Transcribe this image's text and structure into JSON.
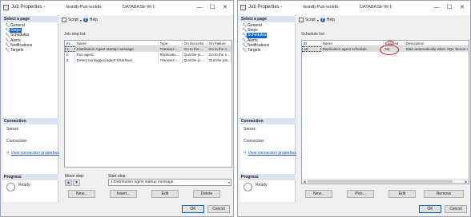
{
  "left_window": {
    "title": "Job Properties -",
    "title_job": "-testdb-Pub-testdb-",
    "title_server": "DATABASE-W-1",
    "select_page_header": "Select a page",
    "pages": [
      "General",
      "Steps",
      "Schedules",
      "Alerts",
      "Notifications",
      "Targets"
    ],
    "selected_page": "Steps",
    "toolbar": {
      "script_label": "Script",
      "help_label": "Help"
    },
    "list_label": "Job step list:",
    "columns": [
      "St...",
      "Name",
      "Type",
      "On Success",
      "On Failure"
    ],
    "rows": [
      [
        "1",
        "Distribution Agent startup message.",
        "Transact-...",
        "Go to the ...",
        "Go to the n..."
      ],
      [
        "2",
        "Run agent.",
        "Replicatio...",
        "Quit the jo...",
        "Go to the n..."
      ],
      [
        "3",
        "Detect nonlogged agent shutdown.",
        "Transact-...",
        "Quit the jo...",
        "Quit the job..."
      ]
    ],
    "connection_header": "Connection",
    "server_label": "Server:",
    "connection_label": "Connection:",
    "view_conn_link": "View connection properties",
    "progress_header": "Progress",
    "progress_status": "Ready",
    "move_step_label": "Move step:",
    "start_step_label": "Start step:",
    "start_step_value": "1:Distribution Agent startup message.",
    "buttons": {
      "new": "New...",
      "insert": "Insert...",
      "edit": "Edit",
      "delete": "Delete",
      "ok": "OK",
      "cancel": "Cancel"
    }
  },
  "right_window": {
    "title": "Job Properties -",
    "title_job": "-testdb-Pub-testdb-",
    "title_server": "DATABASE-W-1",
    "select_page_header": "Select a page",
    "pages": [
      "General",
      "Steps",
      "Schedules",
      "Alerts",
      "Notifications",
      "Targets"
    ],
    "selected_page": "Schedules",
    "toolbar": {
      "script_label": "Script",
      "help_label": "Help"
    },
    "list_label": "Schedule list:",
    "columns": [
      "ID",
      "Name",
      "Enabled",
      "Description"
    ],
    "rows": [
      [
        "18",
        "Replication agent schedule.",
        "No",
        "Start automatically when SQL Server A"
      ]
    ],
    "connection_header": "Connection",
    "server_label": "Server:",
    "connection_label": "Connection:",
    "view_conn_link": "View connection properties",
    "progress_header": "Progress",
    "progress_status": "Ready",
    "buttons": {
      "new": "New...",
      "pick": "Pick...",
      "edit": "Edit",
      "remove": "Remove",
      "ok": "OK",
      "cancel": "Cancel"
    },
    "annotation_color": "#d01818"
  },
  "colors": {
    "selection": "#0a64c8",
    "link": "#1a52b8",
    "section_header": "#dde3ec"
  }
}
